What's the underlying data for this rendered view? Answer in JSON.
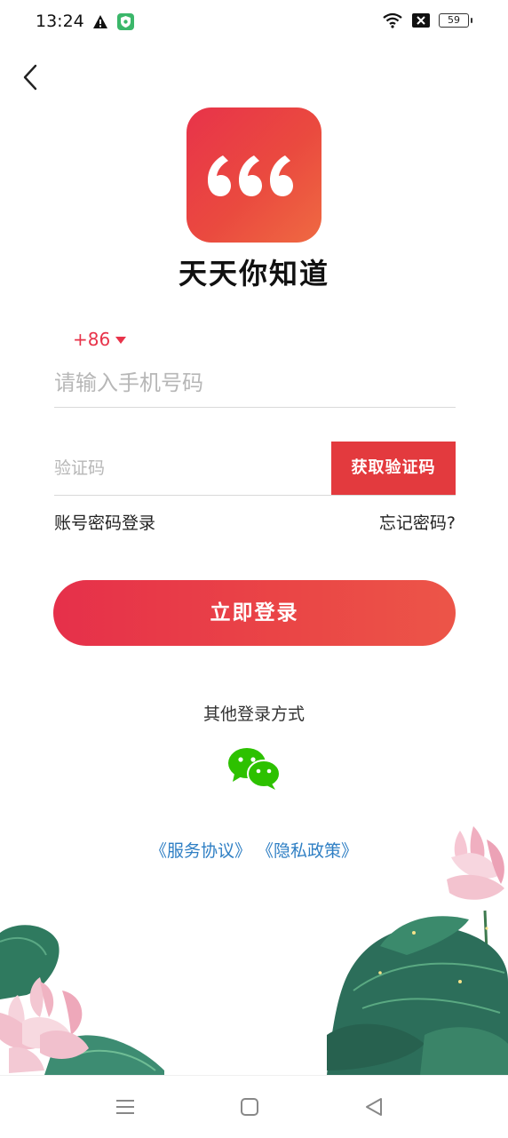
{
  "status_bar": {
    "time": "13:24",
    "battery": "59",
    "icons": [
      "warning-icon",
      "shield-icon",
      "wifi-icon",
      "no-sim-icon",
      "battery-icon"
    ]
  },
  "app": {
    "name": "天天你知道",
    "logo_icon": "quote-marks-icon",
    "brand_color": "#e8334a"
  },
  "form": {
    "country_code": "+86",
    "phone_placeholder": "请输入手机号码",
    "code_placeholder": "验证码",
    "get_code_label": "获取验证码",
    "password_login_label": "账号密码登录",
    "forgot_password_label": "忘记密码?",
    "login_label": "立即登录"
  },
  "other_login": {
    "label": "其他登录方式",
    "methods": [
      "wechat-icon"
    ]
  },
  "agreements": {
    "service": "《服务协议》",
    "privacy": "《隐私政策》",
    "link_color": "#2f7fc4"
  },
  "nav_bar": {
    "buttons": [
      "menu-icon",
      "home-icon",
      "back-triangle-icon"
    ]
  }
}
